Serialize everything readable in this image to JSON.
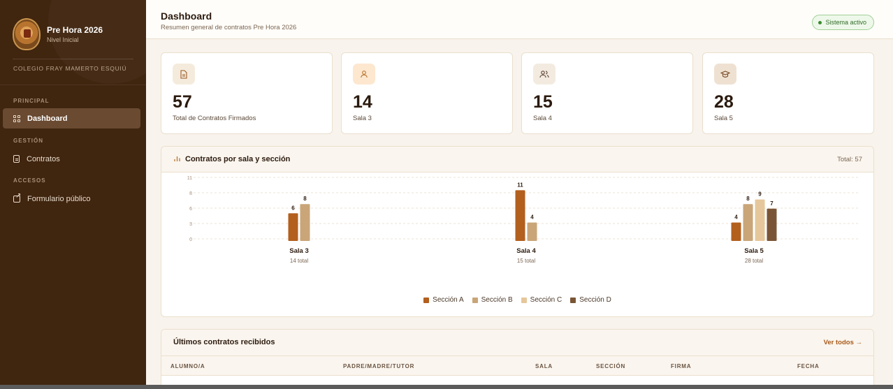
{
  "sidebar": {
    "brand_name": "Pre Hora 2026",
    "brand_sub": "Nivel Inicial",
    "school": "COLEGIO FRAY MAMERTO ESQUIÚ",
    "sections": [
      {
        "label": "PRINCIPAL",
        "items": [
          {
            "label": "Dashboard",
            "icon": "grid-icon",
            "active": true
          }
        ]
      },
      {
        "label": "GESTIÓN",
        "items": [
          {
            "label": "Contratos",
            "icon": "document-icon",
            "active": false
          }
        ]
      },
      {
        "label": "ACCESOS",
        "items": [
          {
            "label": "Formulario público",
            "icon": "external-link-icon",
            "active": false
          }
        ]
      }
    ]
  },
  "header": {
    "title": "Dashboard",
    "subtitle": "Resumen general de contratos Pre Hora 2026",
    "status": "Sistema activo"
  },
  "stats": [
    {
      "value": "57",
      "label": "Total de Contratos Firmados",
      "icon": "document-icon",
      "icon_bg": "#f5ebdd"
    },
    {
      "value": "14",
      "label": "Sala 3",
      "icon": "user-icon",
      "icon_bg": "#fde7cf"
    },
    {
      "value": "15",
      "label": "Sala 4",
      "icon": "users-icon",
      "icon_bg": "#f3ebe0"
    },
    {
      "value": "28",
      "label": "Sala 5",
      "icon": "graduation-cap-icon",
      "icon_bg": "#efe1d2"
    }
  ],
  "chart_panel": {
    "title": "Contratos por sala y sección",
    "total": "Total: 57"
  },
  "chart_data": {
    "type": "bar",
    "categories": [
      "Sala 3",
      "Sala 4",
      "Sala 5"
    ],
    "category_totals": [
      "14 total",
      "15 total",
      "28 total"
    ],
    "y_ticks": [
      0,
      3,
      6,
      8,
      11
    ],
    "series": [
      {
        "name": "Sección A",
        "color": "#b35f1e",
        "values": [
          6,
          11,
          4
        ]
      },
      {
        "name": "Sección B",
        "color": "#c9a578",
        "values": [
          8,
          4,
          8
        ]
      },
      {
        "name": "Sección C",
        "color": "#e6c79b",
        "values": [
          null,
          null,
          9
        ]
      },
      {
        "name": "Sección D",
        "color": "#7a5535",
        "values": [
          null,
          null,
          7
        ]
      }
    ],
    "grid": true,
    "legend": "bottom-center"
  },
  "table_panel": {
    "title": "Últimos contratos recibidos",
    "link": "Ver todos →",
    "columns": [
      "ALUMNO/A",
      "PADRE/MADRE/TUTOR",
      "SALA",
      "SECCIÓN",
      "FIRMA",
      "FECHA"
    ]
  }
}
